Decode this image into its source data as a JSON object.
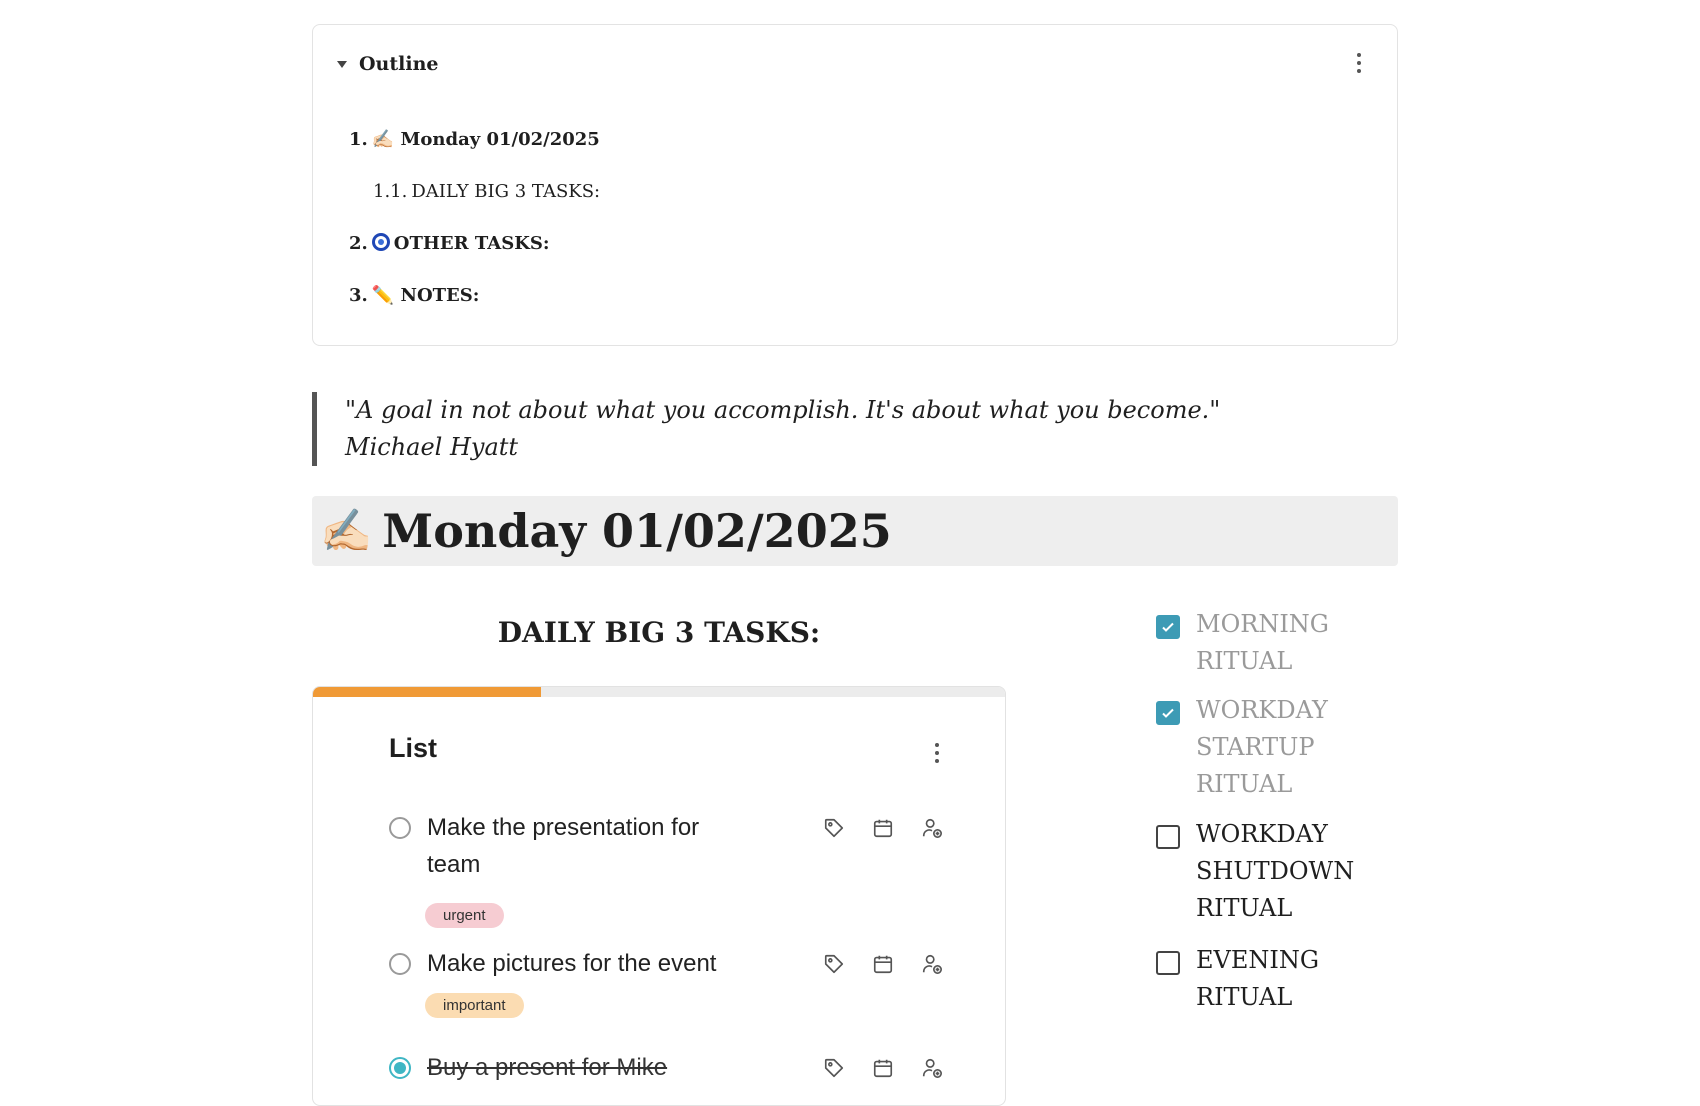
{
  "outline": {
    "title": "Outline",
    "items": [
      {
        "num": "1.",
        "emoji": "✍🏻",
        "text": "Monday 01/02/2025"
      },
      {
        "num": "1.1.",
        "text": "DAILY BIG 3 TASKS:"
      },
      {
        "num": "2.",
        "text": "OTHER TASKS:"
      },
      {
        "num": "3.",
        "emoji": "✏️",
        "text": " NOTES:"
      }
    ]
  },
  "quote": {
    "text": "\"A goal in not about what you accomplish. It's about what you become.\"",
    "author": "Michael Hyatt"
  },
  "day": {
    "emoji": "✍🏻",
    "title": "Monday 01/02/2025"
  },
  "big3": {
    "heading": "DAILY BIG 3 TASKS:",
    "list_title": "List",
    "progress": 0.33,
    "tasks": [
      {
        "text": "Make the presentation for team",
        "tag": "urgent",
        "done": false
      },
      {
        "text": "Make pictures for the event",
        "tag": "important",
        "done": false
      },
      {
        "text": "Buy a present for Mike",
        "done": true
      }
    ]
  },
  "rituals": [
    {
      "label": "MORNING RITUAL",
      "checked": true
    },
    {
      "label": "WORKDAY STARTUP RITUAL",
      "checked": true
    },
    {
      "label": "WORKDAY SHUTDOWN RITUAL",
      "checked": false
    },
    {
      "label": "EVENING RITUAL",
      "checked": false
    }
  ],
  "colors": {
    "progress": "#f09a36",
    "check": "#3d9bb5",
    "radio_done": "#3fb6c4",
    "tag_urgent": "#f6ccd2",
    "tag_important": "#fbdcb2"
  }
}
